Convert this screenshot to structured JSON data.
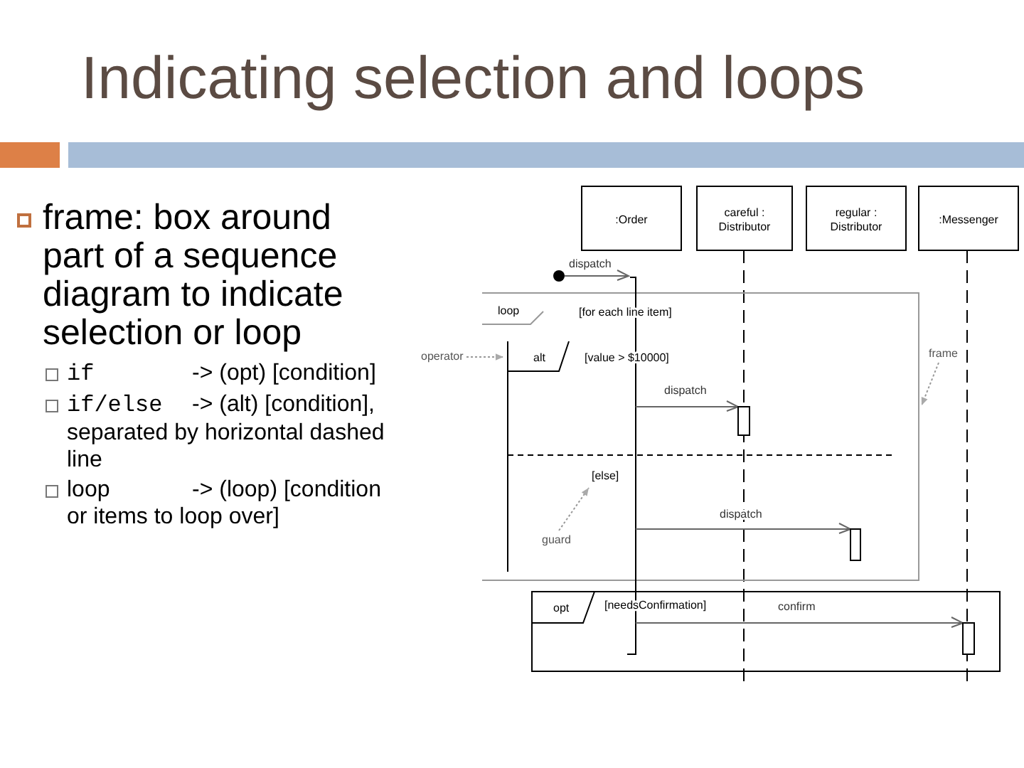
{
  "title": "Indicating selection and loops",
  "bullets": [
    {
      "text": "frame: box around part of a sequence diagram to indicate selection or loop",
      "sub_items": [
        {
          "kind": "code",
          "keyword": "if",
          "text": "-> (opt) [condition]"
        },
        {
          "kind": "code",
          "keyword": "if/else",
          "text": "-> (alt) [condition], separated by horizontal dashed line"
        },
        {
          "kind": "plain",
          "keyword": "loop",
          "text": "-> (loop) [condition or items to loop over]"
        }
      ]
    }
  ],
  "diagram": {
    "lifelines": [
      {
        "lines": [
          ":Order"
        ]
      },
      {
        "lines": [
          "careful :",
          "Distributor"
        ]
      },
      {
        "lines": [
          "regular :",
          "Distributor"
        ]
      },
      {
        "lines": [
          ":Messenger"
        ]
      }
    ],
    "messages": [
      "dispatch",
      "dispatch",
      "dispatch",
      "confirm"
    ],
    "frames": [
      {
        "operator": "loop",
        "guards": [
          "[for each line item]"
        ]
      },
      {
        "operator": "alt",
        "guards": [
          "[value > $10000]",
          "[else]"
        ]
      },
      {
        "operator": "opt",
        "guards": [
          "[needsConfirmation]"
        ]
      }
    ],
    "annotations": [
      "operator",
      "frame",
      "guard"
    ]
  }
}
